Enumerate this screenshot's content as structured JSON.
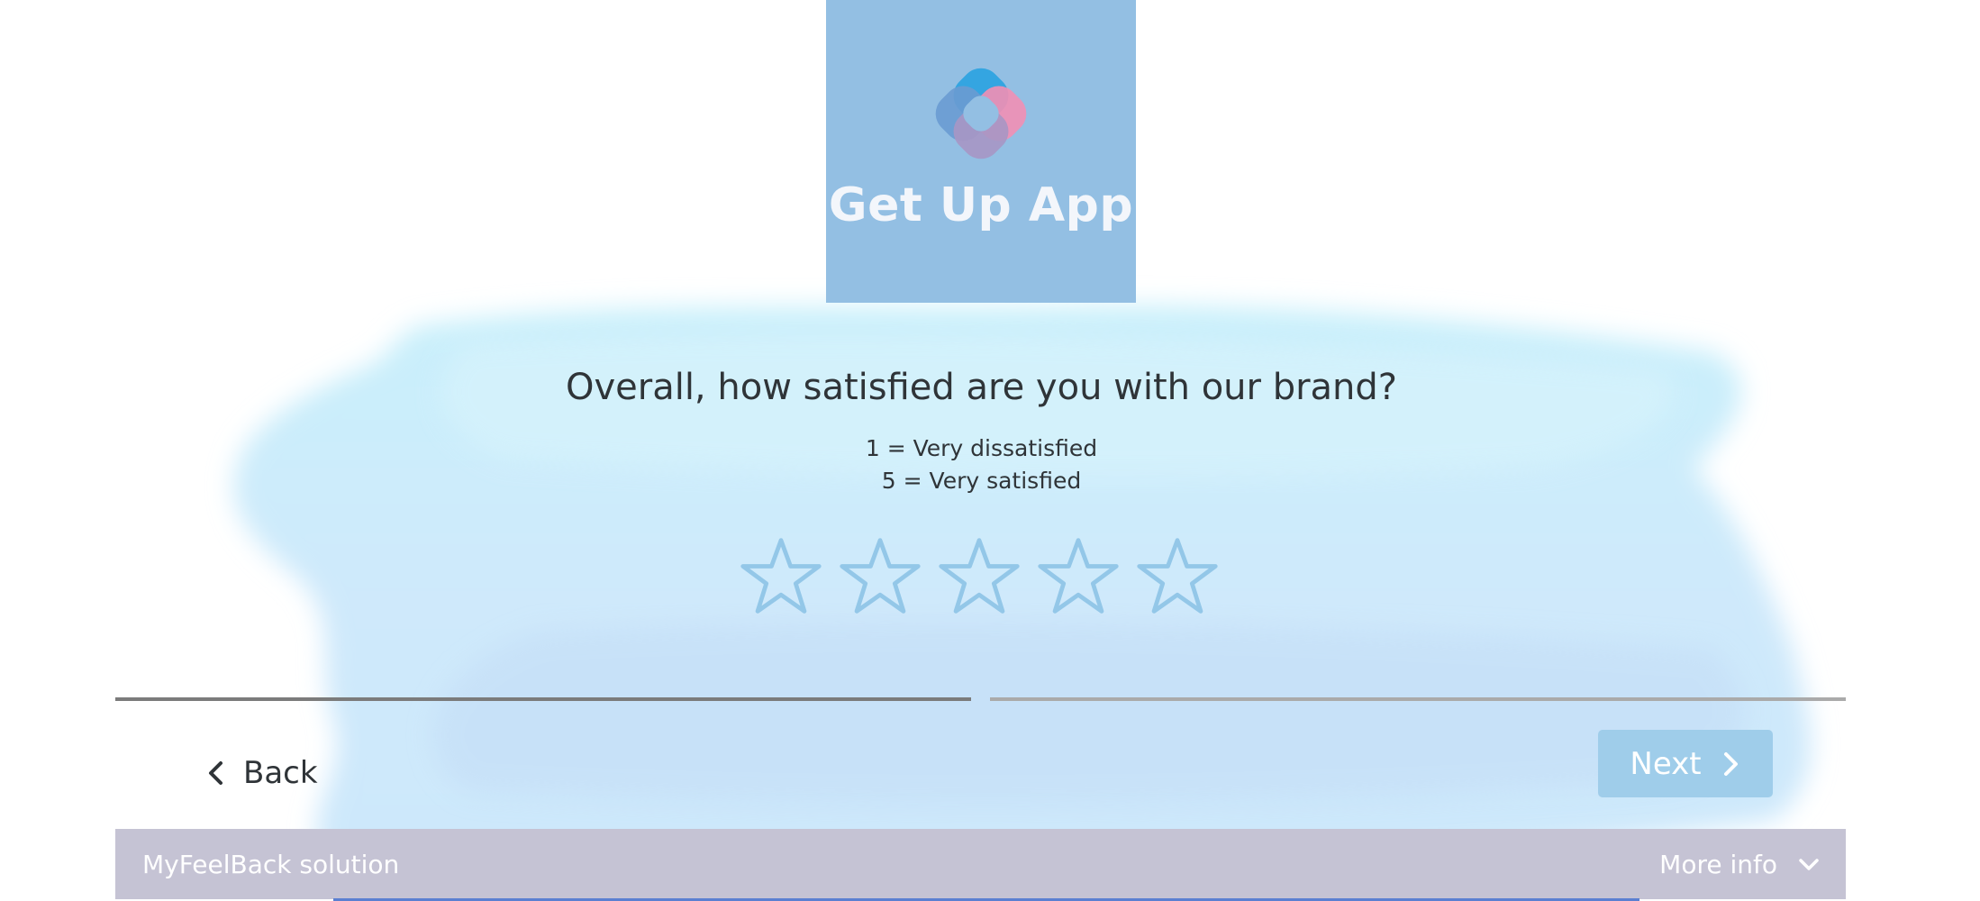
{
  "brand": {
    "name": "Get Up App",
    "logo_icon": "overlapping-rounded-squares-logo",
    "logo_bg_color": "#93bfe3",
    "logo_colors": [
      "#2ea3e0",
      "#f28fb4",
      "#6a9bd1",
      "#a796c4"
    ]
  },
  "question": {
    "title": "Overall, how satisfied are you with our brand?",
    "scale_min_label": "1 = Very dissatisfied",
    "scale_max_label": "5 = Very satisfied"
  },
  "rating": {
    "max": 5,
    "selected": 0,
    "star_icon": "star-outline-icon",
    "star_color": "#93c7e8"
  },
  "progress": {
    "segments": 2,
    "current_segment": 1,
    "active_color": "#7b7b7b",
    "inactive_color": "#aaaaaa"
  },
  "navigation": {
    "back_label": "Back",
    "back_icon": "chevron-left-icon",
    "next_label": "Next",
    "next_icon": "chevron-right-icon",
    "next_bg_color": "#9fcdea"
  },
  "footer": {
    "left_label": "MyFeelBack solution",
    "right_label": "More info",
    "right_icon": "chevron-down-icon",
    "bg_color": "#c5c3d4"
  }
}
